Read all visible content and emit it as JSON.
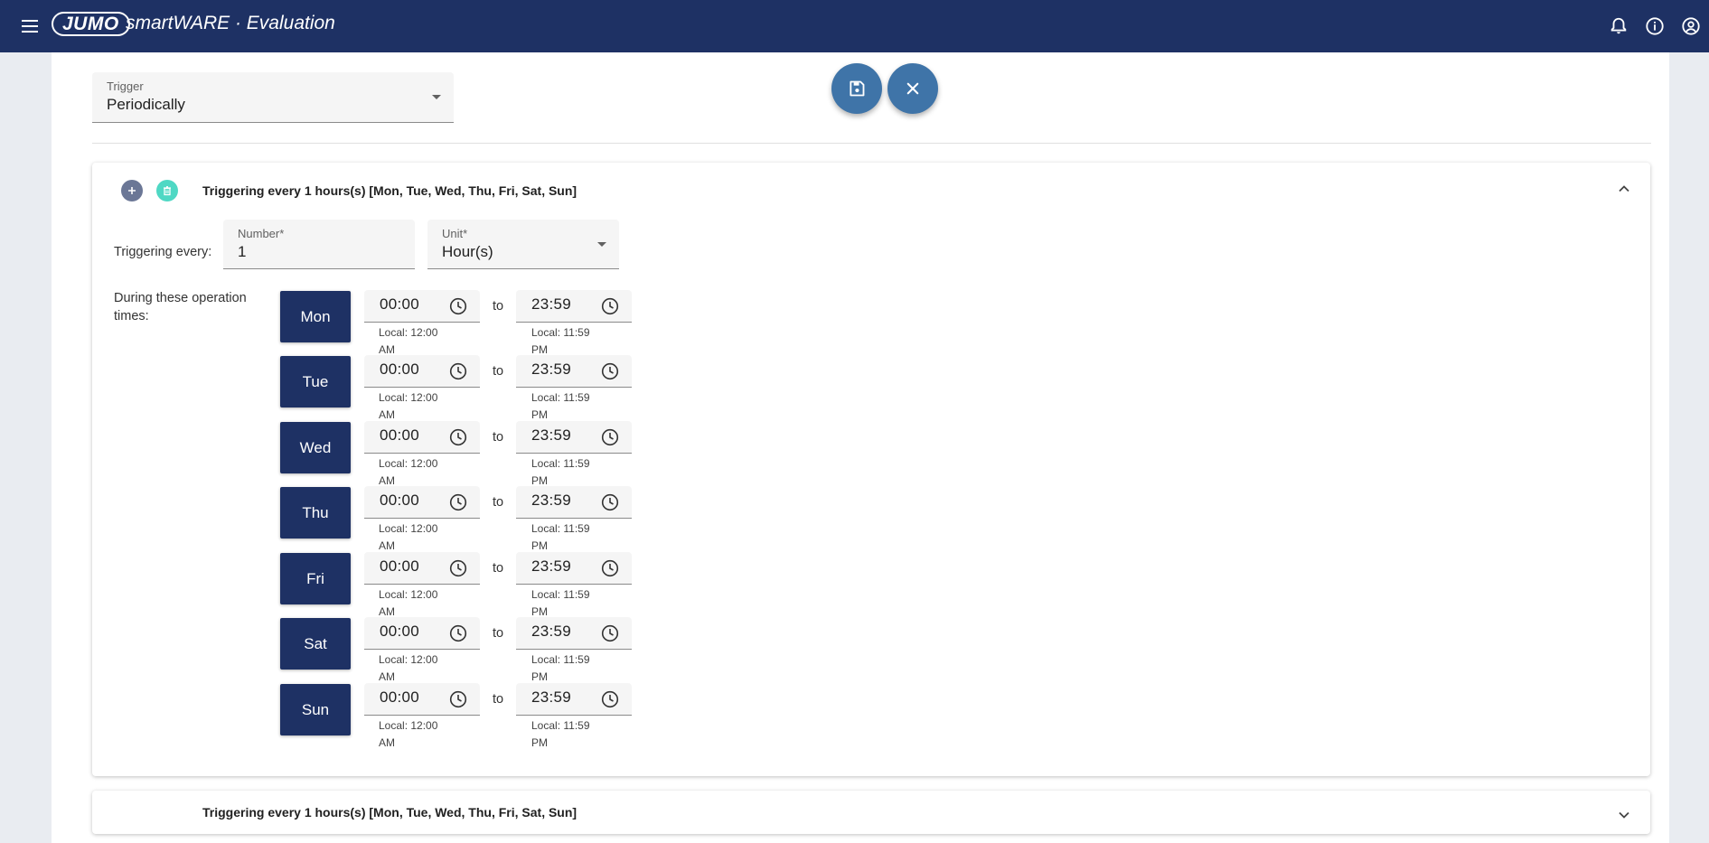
{
  "header": {
    "logo_text": "JUMO",
    "app_title": "smartWARE · Evaluation",
    "icons": [
      "menu-icon",
      "bell-icon",
      "info-icon",
      "account-icon"
    ]
  },
  "trigger": {
    "label": "Trigger",
    "value": "Periodically"
  },
  "actions": {
    "icons": [
      "save-icon",
      "close-icon"
    ]
  },
  "panels": [
    {
      "title": "Triggering every 1 hours(s) [Mon, Tue, Wed, Thu, Fri, Sat, Sun]",
      "expanded": true,
      "triggering_every_label": "Triggering every:",
      "number": {
        "label": "Number*",
        "value": "1"
      },
      "unit": {
        "label": "Unit*",
        "value": "Hour(s)"
      },
      "operation_times_label": "During these operation times:",
      "to_label": "to",
      "days": [
        {
          "day": "Mon",
          "from": "00:00",
          "from_local": "Local: 12:00 AM",
          "to": "23:59",
          "to_local": "Local: 11:59 PM"
        },
        {
          "day": "Tue",
          "from": "00:00",
          "from_local": "Local: 12:00 AM",
          "to": "23:59",
          "to_local": "Local: 11:59 PM"
        },
        {
          "day": "Wed",
          "from": "00:00",
          "from_local": "Local: 12:00 AM",
          "to": "23:59",
          "to_local": "Local: 11:59 PM"
        },
        {
          "day": "Thu",
          "from": "00:00",
          "from_local": "Local: 12:00 AM",
          "to": "23:59",
          "to_local": "Local: 11:59 PM"
        },
        {
          "day": "Fri",
          "from": "00:00",
          "from_local": "Local: 12:00 AM",
          "to": "23:59",
          "to_local": "Local: 11:59 PM"
        },
        {
          "day": "Sat",
          "from": "00:00",
          "from_local": "Local: 12:00 AM",
          "to": "23:59",
          "to_local": "Local: 11:59 PM"
        },
        {
          "day": "Sun",
          "from": "00:00",
          "from_local": "Local: 12:00 AM",
          "to": "23:59",
          "to_local": "Local: 11:59 PM"
        }
      ]
    },
    {
      "title": "Triggering every 1 hours(s) [Mon, Tue, Wed, Thu, Fri, Sat, Sun]",
      "expanded": false
    }
  ],
  "colors": {
    "header_bg": "#1e3164",
    "day_button_bg": "#1e3164",
    "fab_bg": "#3f74a8",
    "add_circle_bg": "#6b7796",
    "delete_circle_bg": "#4fd8c4"
  }
}
